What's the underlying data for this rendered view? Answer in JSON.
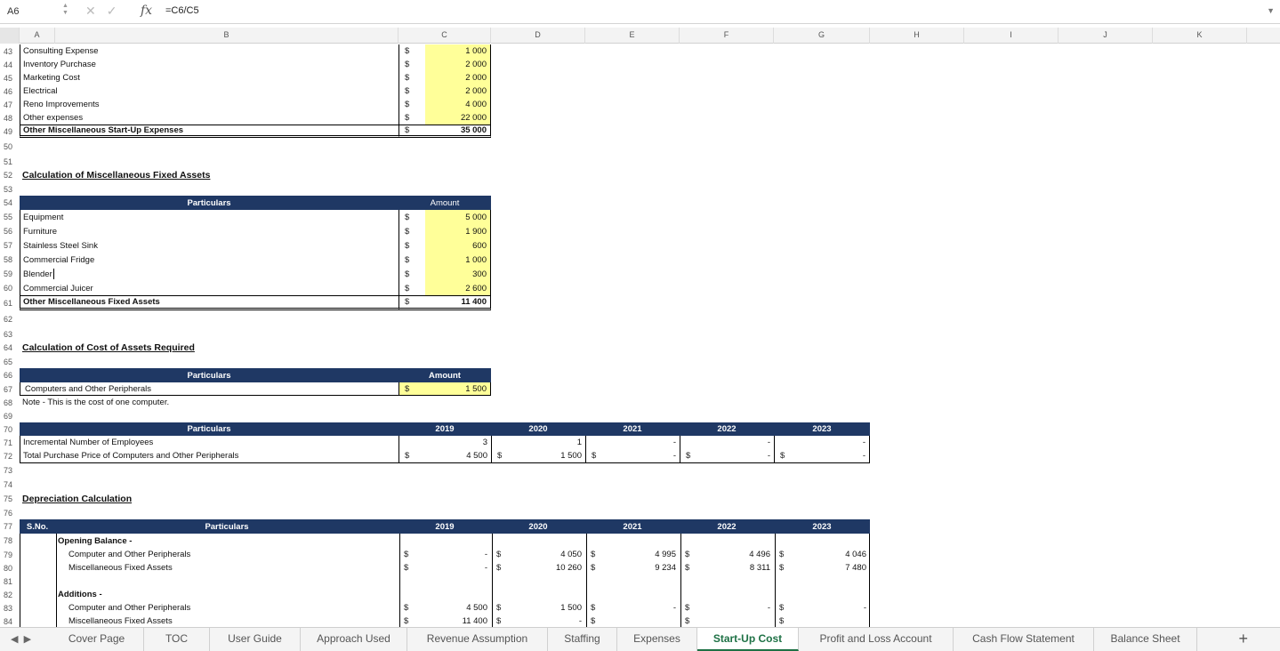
{
  "formula_bar": {
    "cell_ref": "A6",
    "fx": "fx",
    "formula": "=C6/C5"
  },
  "columns": [
    "A",
    "B",
    "C",
    "D",
    "E",
    "F",
    "G",
    "H",
    "I",
    "J",
    "K"
  ],
  "currency": "$",
  "dash": "-",
  "misc_startup": {
    "rows": [
      {
        "n": "43",
        "label": "Consulting Expense",
        "amt": "1 000"
      },
      {
        "n": "44",
        "label": "Inventory Purchase",
        "amt": "2 000"
      },
      {
        "n": "45",
        "label": "Marketing Cost",
        "amt": "2 000"
      },
      {
        "n": "46",
        "label": "Electrical",
        "amt": "2 000"
      },
      {
        "n": "47",
        "label": "Reno Improvements",
        "amt": "4 000"
      },
      {
        "n": "48",
        "label": "Other expenses",
        "amt": "22 000"
      }
    ],
    "total": {
      "n": "49",
      "label": "Other Miscellaneous Start-Up Expenses",
      "amt": "35 000"
    }
  },
  "fixed_assets": {
    "title": "Calculation of Miscellaneous Fixed Assets",
    "header_particulars": "Particulars",
    "header_amount": "Amount",
    "rows": [
      {
        "n": "55",
        "label": "Equipment",
        "amt": "5 000"
      },
      {
        "n": "56",
        "label": "Furniture",
        "amt": "1 900"
      },
      {
        "n": "57",
        "label": "Stainless Steel Sink",
        "amt": "600"
      },
      {
        "n": "58",
        "label": "Commercial Fridge",
        "amt": "1 000"
      },
      {
        "n": "59",
        "label": "Blender",
        "amt": "300"
      },
      {
        "n": "60",
        "label": "Commercial Juicer",
        "amt": "2 600"
      }
    ],
    "total": {
      "n": "61",
      "label": "Other Miscellaneous Fixed Assets",
      "amt": "11 400"
    }
  },
  "cost_assets": {
    "title": "Calculation of Cost of Assets Required",
    "header_particulars": "Particulars",
    "header_amount": "Amount",
    "row": {
      "label": "Computers and Other Peripherals",
      "amt": "1 500"
    },
    "note": "Note - This is the cost of one computer."
  },
  "years": [
    "2019",
    "2020",
    "2021",
    "2022",
    "2023"
  ],
  "computers": {
    "header_particulars": "Particulars",
    "employees": {
      "label": "Incremental Number of Employees",
      "values": [
        "3",
        "1",
        "-",
        "-",
        "-"
      ]
    },
    "purchase": {
      "label": "Total Purchase Price of Computers and Other Peripherals",
      "values": [
        "4 500",
        "1 500",
        "-",
        "-",
        "-"
      ]
    }
  },
  "depreciation": {
    "title": "Depreciation Calculation",
    "header_sno": "S.No.",
    "header_particulars": "Particulars",
    "opening_label": "Opening Balance -",
    "opening_comp": {
      "label": "Computer and Other Peripherals",
      "values": [
        "-",
        "4 050",
        "4 995",
        "4 496",
        "4 046"
      ]
    },
    "opening_misc": {
      "label": "Miscellaneous Fixed Assets",
      "values": [
        "-",
        "10 260",
        "9 234",
        "8 311",
        "7 480"
      ]
    },
    "additions_label": "Additions -",
    "add_comp": {
      "label": "Computer and Other Peripherals",
      "values": [
        "4 500",
        "1 500",
        "-",
        "-",
        "-"
      ]
    },
    "add_misc": {
      "label": "Miscellaneous Fixed Assets",
      "values": [
        "11 400",
        "-",
        "",
        "",
        ""
      ]
    }
  },
  "tabs": [
    "Cover Page",
    "TOC",
    "User Guide",
    "Approach Used",
    "Revenue Assumption",
    "Staffing",
    "Expenses",
    "Start-Up Cost",
    "Profit and Loss Account",
    "Cash Flow Statement",
    "Balance Sheet"
  ],
  "active_tab": "Start-Up Cost",
  "add_sheet": "+"
}
